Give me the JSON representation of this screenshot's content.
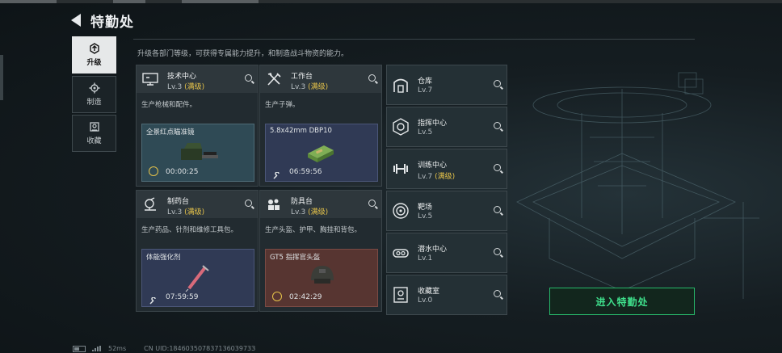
{
  "header": {
    "title": "特勤处"
  },
  "description": "升级各部门等级，可获得专属能力提升，和制造战斗物资的能力。",
  "nav": [
    {
      "label": "升级",
      "icon": "upgrade-icon",
      "active": true
    },
    {
      "label": "制造",
      "icon": "gear-icon",
      "active": false
    },
    {
      "label": "收藏",
      "icon": "collection-icon",
      "active": false
    }
  ],
  "cards": [
    {
      "name": "技术中心",
      "level": "Lv.3",
      "max": "(满级)",
      "desc": "生产枪械和配件。",
      "icon": "monitor-icon",
      "product": {
        "name": "全景红点瞄准镜",
        "time": "00:00:25",
        "color": "teal",
        "icon": "scope-item-icon"
      }
    },
    {
      "name": "工作台",
      "level": "Lv.3",
      "max": "(满级)",
      "desc": "生产子弹。",
      "icon": "tools-icon",
      "product": {
        "name": "5.8x42mm DBP10",
        "time": "06:59:56",
        "color": "blue",
        "icon": "ammo-box-icon"
      }
    },
    {
      "name": "制药台",
      "level": "Lv.3",
      "max": "(满级)",
      "desc": "生产药品、针剂和维修工具包。",
      "icon": "microscope-icon",
      "product": {
        "name": "体能强化剂",
        "time": "07:59:59",
        "color": "blue",
        "icon": "syringe-item-icon"
      }
    },
    {
      "name": "防具台",
      "level": "Lv.3",
      "max": "(满级)",
      "desc": "生产头盔、护甲、胸挂和背包。",
      "icon": "armor-icon",
      "product": {
        "name": "GT5 指挥官头盔",
        "time": "02:42:29",
        "color": "brown",
        "icon": "helmet-item-icon"
      }
    }
  ],
  "facilities": [
    {
      "name": "仓库",
      "level": "Lv.7",
      "max": "",
      "icon": "warehouse-icon"
    },
    {
      "name": "指挥中心",
      "level": "Lv.5",
      "max": "",
      "icon": "command-icon"
    },
    {
      "name": "训练中心",
      "level": "Lv.7",
      "max": "(满级)",
      "icon": "dumbbell-icon"
    },
    {
      "name": "靶场",
      "level": "Lv.5",
      "max": "",
      "icon": "target-icon"
    },
    {
      "name": "潜水中心",
      "level": "Lv.1",
      "max": "",
      "icon": "diving-icon"
    },
    {
      "name": "收藏室",
      "level": "Lv.0",
      "max": "",
      "icon": "trophy-icon"
    }
  ],
  "enter_button": "进入特勤处",
  "status": {
    "ping": "52ms",
    "uid": "CN UID:18460350783713603973З"
  },
  "colors": {
    "accent_green": "#27b86a",
    "max_level": "#e6c34a"
  }
}
